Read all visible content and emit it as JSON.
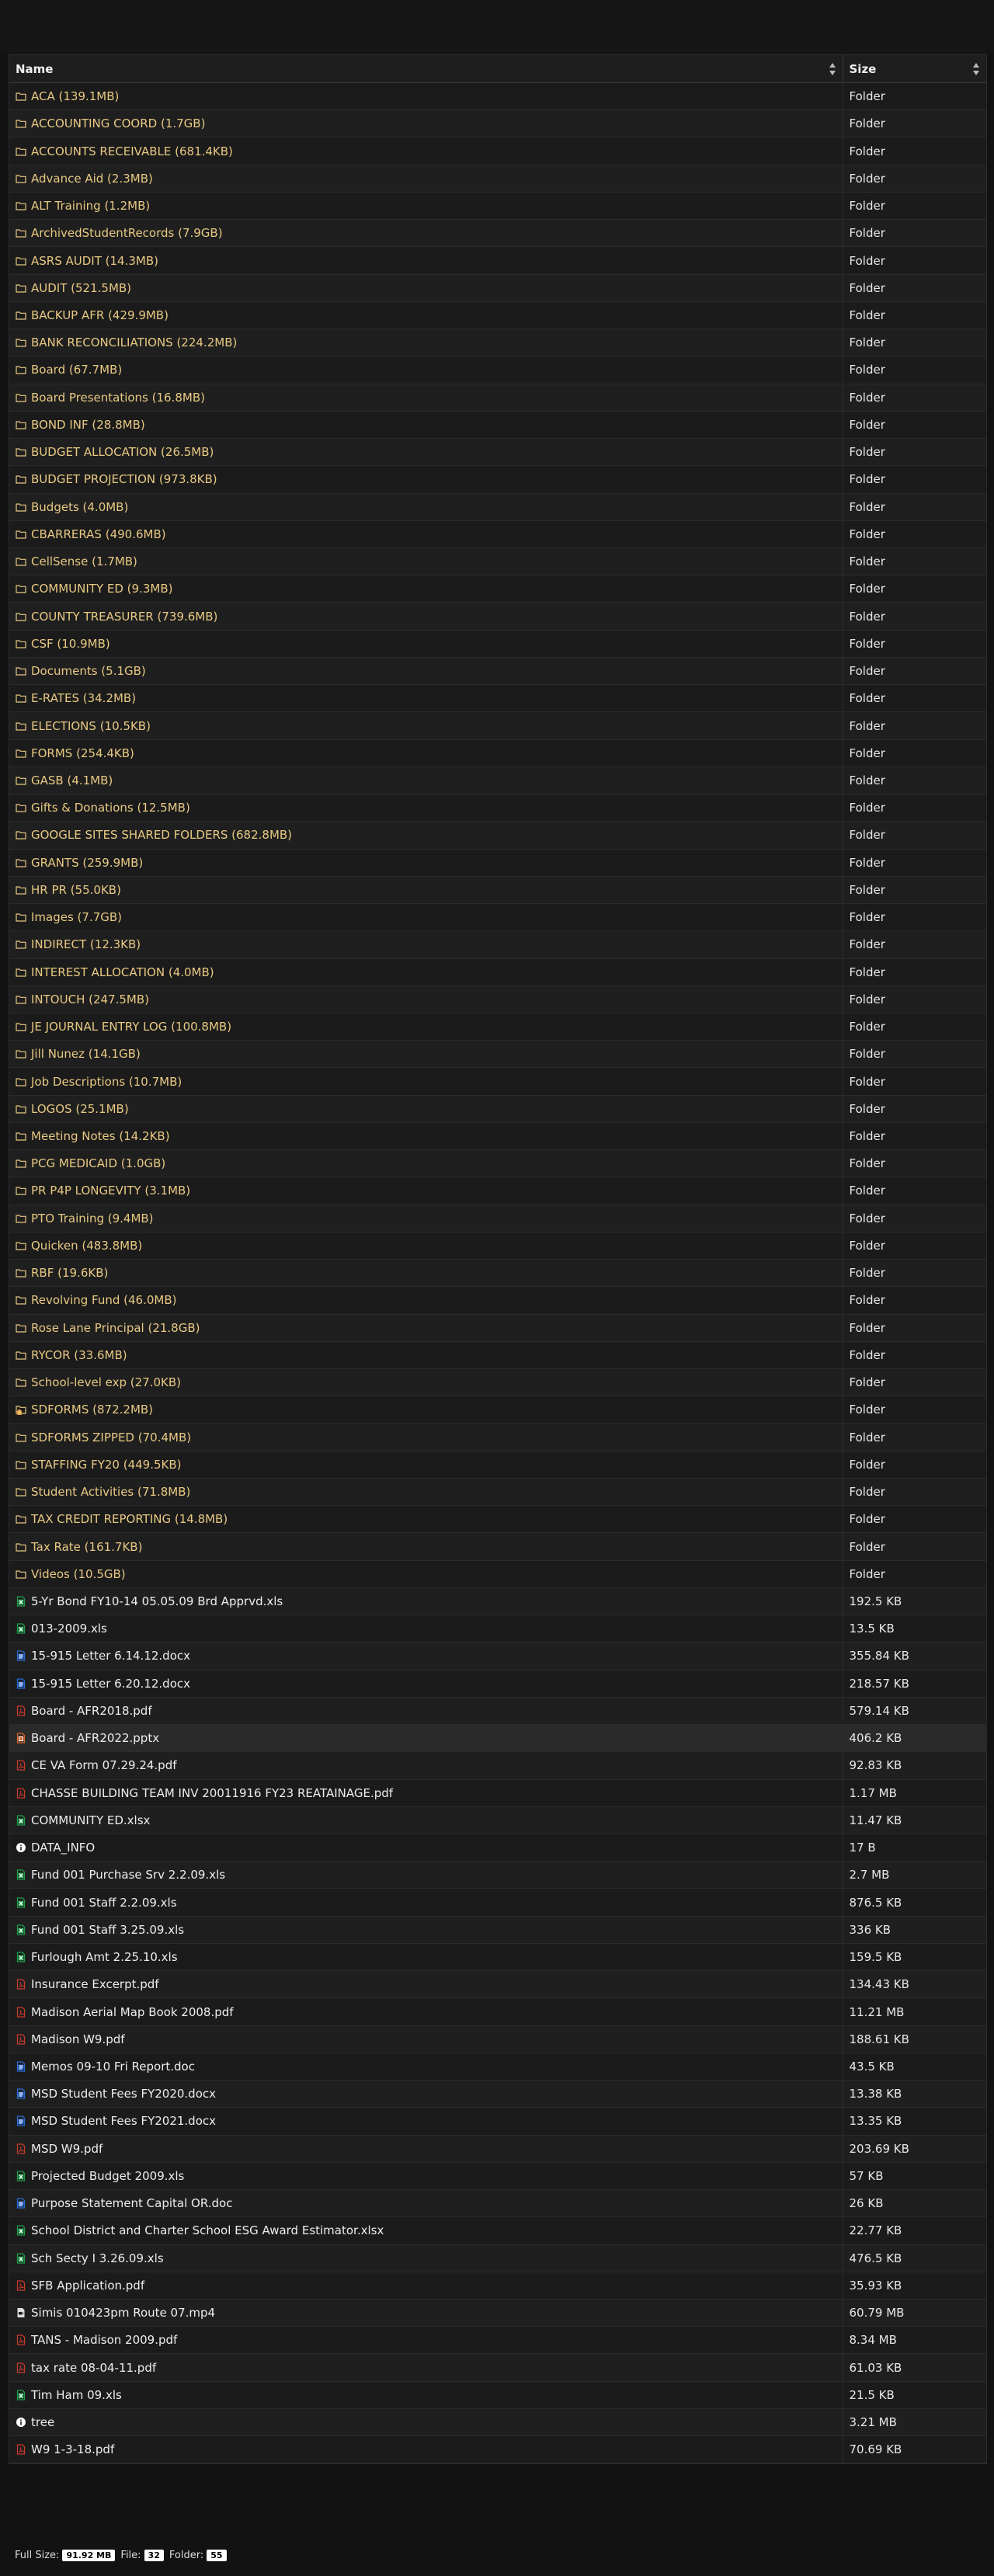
{
  "columns": {
    "name": "Name",
    "size": "Size"
  },
  "colors": {
    "folder_text": "#e8c983",
    "file_text": "#eeeeee",
    "excel": "#1e9c4a",
    "word": "#2a6ad6",
    "pdf": "#c83a2e",
    "ppt": "#d5632a",
    "video": "#dddddd",
    "info": "#ffffff"
  },
  "rows": [
    {
      "name": "ACA (139.1MB)",
      "size": "Folder",
      "kind": "folder"
    },
    {
      "name": "ACCOUNTING COORD (1.7GB)",
      "size": "Folder",
      "kind": "folder"
    },
    {
      "name": "ACCOUNTS RECEIVABLE (681.4KB)",
      "size": "Folder",
      "kind": "folder"
    },
    {
      "name": "Advance Aid (2.3MB)",
      "size": "Folder",
      "kind": "folder"
    },
    {
      "name": "ALT Training (1.2MB)",
      "size": "Folder",
      "kind": "folder"
    },
    {
      "name": "ArchivedStudentRecords (7.9GB)",
      "size": "Folder",
      "kind": "folder"
    },
    {
      "name": "ASRS AUDIT (14.3MB)",
      "size": "Folder",
      "kind": "folder"
    },
    {
      "name": "AUDIT (521.5MB)",
      "size": "Folder",
      "kind": "folder"
    },
    {
      "name": "BACKUP AFR (429.9MB)",
      "size": "Folder",
      "kind": "folder"
    },
    {
      "name": "BANK RECONCILIATIONS (224.2MB)",
      "size": "Folder",
      "kind": "folder"
    },
    {
      "name": "Board (67.7MB)",
      "size": "Folder",
      "kind": "folder"
    },
    {
      "name": "Board Presentations (16.8MB)",
      "size": "Folder",
      "kind": "folder"
    },
    {
      "name": "BOND INF (28.8MB)",
      "size": "Folder",
      "kind": "folder"
    },
    {
      "name": "BUDGET ALLOCATION (26.5MB)",
      "size": "Folder",
      "kind": "folder"
    },
    {
      "name": "BUDGET PROJECTION (973.8KB)",
      "size": "Folder",
      "kind": "folder"
    },
    {
      "name": "Budgets (4.0MB)",
      "size": "Folder",
      "kind": "folder"
    },
    {
      "name": "CBARRERAS (490.6MB)",
      "size": "Folder",
      "kind": "folder"
    },
    {
      "name": "CellSense (1.7MB)",
      "size": "Folder",
      "kind": "folder"
    },
    {
      "name": "COMMUNITY ED (9.3MB)",
      "size": "Folder",
      "kind": "folder"
    },
    {
      "name": "COUNTY TREASURER (739.6MB)",
      "size": "Folder",
      "kind": "folder"
    },
    {
      "name": "CSF (10.9MB)",
      "size": "Folder",
      "kind": "folder"
    },
    {
      "name": "Documents (5.1GB)",
      "size": "Folder",
      "kind": "folder"
    },
    {
      "name": "E-RATES (34.2MB)",
      "size": "Folder",
      "kind": "folder"
    },
    {
      "name": "ELECTIONS (10.5KB)",
      "size": "Folder",
      "kind": "folder"
    },
    {
      "name": "FORMS (254.4KB)",
      "size": "Folder",
      "kind": "folder"
    },
    {
      "name": "GASB (4.1MB)",
      "size": "Folder",
      "kind": "folder"
    },
    {
      "name": "Gifts & Donations (12.5MB)",
      "size": "Folder",
      "kind": "folder"
    },
    {
      "name": "GOOGLE SITES SHARED FOLDERS (682.8MB)",
      "size": "Folder",
      "kind": "folder"
    },
    {
      "name": "GRANTS (259.9MB)",
      "size": "Folder",
      "kind": "folder"
    },
    {
      "name": "HR PR (55.0KB)",
      "size": "Folder",
      "kind": "folder"
    },
    {
      "name": "Images (7.7GB)",
      "size": "Folder",
      "kind": "folder"
    },
    {
      "name": "INDIRECT (12.3KB)",
      "size": "Folder",
      "kind": "folder"
    },
    {
      "name": "INTEREST ALLOCATION (4.0MB)",
      "size": "Folder",
      "kind": "folder"
    },
    {
      "name": "INTOUCH (247.5MB)",
      "size": "Folder",
      "kind": "folder"
    },
    {
      "name": "JE JOURNAL ENTRY LOG (100.8MB)",
      "size": "Folder",
      "kind": "folder"
    },
    {
      "name": "Jill Nunez (14.1GB)",
      "size": "Folder",
      "kind": "folder"
    },
    {
      "name": "Job Descriptions (10.7MB)",
      "size": "Folder",
      "kind": "folder"
    },
    {
      "name": "LOGOS (25.1MB)",
      "size": "Folder",
      "kind": "folder"
    },
    {
      "name": "Meeting Notes (14.2KB)",
      "size": "Folder",
      "kind": "folder"
    },
    {
      "name": "PCG MEDICAID (1.0GB)",
      "size": "Folder",
      "kind": "folder"
    },
    {
      "name": "PR P4P LONGEVITY (3.1MB)",
      "size": "Folder",
      "kind": "folder"
    },
    {
      "name": "PTO Training (9.4MB)",
      "size": "Folder",
      "kind": "folder"
    },
    {
      "name": "Quicken (483.8MB)",
      "size": "Folder",
      "kind": "folder"
    },
    {
      "name": "RBF (19.6KB)",
      "size": "Folder",
      "kind": "folder"
    },
    {
      "name": "Revolving Fund (46.0MB)",
      "size": "Folder",
      "kind": "folder"
    },
    {
      "name": "Rose Lane Principal (21.8GB)",
      "size": "Folder",
      "kind": "folder"
    },
    {
      "name": "RYCOR (33.6MB)",
      "size": "Folder",
      "kind": "folder"
    },
    {
      "name": "School-level exp (27.0KB)",
      "size": "Folder",
      "kind": "folder"
    },
    {
      "name": "SDFORMS (872.2MB)",
      "size": "Folder",
      "kind": "folder-home"
    },
    {
      "name": "SDFORMS ZIPPED (70.4MB)",
      "size": "Folder",
      "kind": "folder"
    },
    {
      "name": "STAFFING FY20 (449.5KB)",
      "size": "Folder",
      "kind": "folder"
    },
    {
      "name": "Student Activities (71.8MB)",
      "size": "Folder",
      "kind": "folder"
    },
    {
      "name": "TAX CREDIT REPORTING (14.8MB)",
      "size": "Folder",
      "kind": "folder"
    },
    {
      "name": "Tax Rate (161.7KB)",
      "size": "Folder",
      "kind": "folder"
    },
    {
      "name": "Videos (10.5GB)",
      "size": "Folder",
      "kind": "folder"
    },
    {
      "name": "5-Yr Bond FY10-14 05.05.09 Brd Apprvd.xls",
      "size": "192.5 KB",
      "kind": "excel"
    },
    {
      "name": "013-2009.xls",
      "size": "13.5 KB",
      "kind": "excel"
    },
    {
      "name": "15-915 Letter 6.14.12.docx",
      "size": "355.84 KB",
      "kind": "word"
    },
    {
      "name": "15-915 Letter 6.20.12.docx",
      "size": "218.57 KB",
      "kind": "word"
    },
    {
      "name": "Board - AFR2018.pdf",
      "size": "579.14 KB",
      "kind": "pdf"
    },
    {
      "name": "Board - AFR2022.pptx",
      "size": "406.2 KB",
      "kind": "ppt",
      "highlight": true
    },
    {
      "name": "CE VA Form 07.29.24.pdf",
      "size": "92.83 KB",
      "kind": "pdf"
    },
    {
      "name": "CHASSE BUILDING TEAM INV 20011916 FY23 REATAINAGE.pdf",
      "size": "1.17 MB",
      "kind": "pdf"
    },
    {
      "name": "COMMUNITY ED.xlsx",
      "size": "11.47 KB",
      "kind": "excel"
    },
    {
      "name": "DATA_INFO",
      "size": "17 B",
      "kind": "info"
    },
    {
      "name": "Fund 001 Purchase Srv 2.2.09.xls",
      "size": "2.7 MB",
      "kind": "excel"
    },
    {
      "name": "Fund 001 Staff 2.2.09.xls",
      "size": "876.5 KB",
      "kind": "excel"
    },
    {
      "name": "Fund 001 Staff 3.25.09.xls",
      "size": "336 KB",
      "kind": "excel"
    },
    {
      "name": "Furlough Amt 2.25.10.xls",
      "size": "159.5 KB",
      "kind": "excel"
    },
    {
      "name": "Insurance Excerpt.pdf",
      "size": "134.43 KB",
      "kind": "pdf"
    },
    {
      "name": "Madison Aerial Map Book 2008.pdf",
      "size": "11.21 MB",
      "kind": "pdf"
    },
    {
      "name": "Madison W9.pdf",
      "size": "188.61 KB",
      "kind": "pdf"
    },
    {
      "name": "Memos 09-10 Fri Report.doc",
      "size": "43.5 KB",
      "kind": "word"
    },
    {
      "name": "MSD Student Fees FY2020.docx",
      "size": "13.38 KB",
      "kind": "word"
    },
    {
      "name": "MSD Student Fees FY2021.docx",
      "size": "13.35 KB",
      "kind": "word"
    },
    {
      "name": "MSD W9.pdf",
      "size": "203.69 KB",
      "kind": "pdf"
    },
    {
      "name": "Projected Budget 2009.xls",
      "size": "57 KB",
      "kind": "excel"
    },
    {
      "name": "Purpose Statement Capital OR.doc",
      "size": "26 KB",
      "kind": "word"
    },
    {
      "name": "School District and Charter School ESG Award Estimator.xlsx",
      "size": "22.77 KB",
      "kind": "excel"
    },
    {
      "name": "Sch Secty I 3.26.09.xls",
      "size": "476.5 KB",
      "kind": "excel"
    },
    {
      "name": "SFB Application.pdf",
      "size": "35.93 KB",
      "kind": "pdf"
    },
    {
      "name": "Simis 010423pm Route 07.mp4",
      "size": "60.79 MB",
      "kind": "video"
    },
    {
      "name": "TANS - Madison 2009.pdf",
      "size": "8.34 MB",
      "kind": "pdf"
    },
    {
      "name": "tax rate 08-04-11.pdf",
      "size": "61.03 KB",
      "kind": "pdf"
    },
    {
      "name": "Tim Ham 09.xls",
      "size": "21.5 KB",
      "kind": "excel"
    },
    {
      "name": "tree",
      "size": "3.21 MB",
      "kind": "info"
    },
    {
      "name": "W9 1-3-18.pdf",
      "size": "70.69 KB",
      "kind": "pdf"
    }
  ],
  "footer": {
    "full_size_label": "Full Size:",
    "full_size_value": "91.92 MB",
    "file_label": "File:",
    "file_value": "32",
    "folder_label": "Folder:",
    "folder_value": "55"
  }
}
